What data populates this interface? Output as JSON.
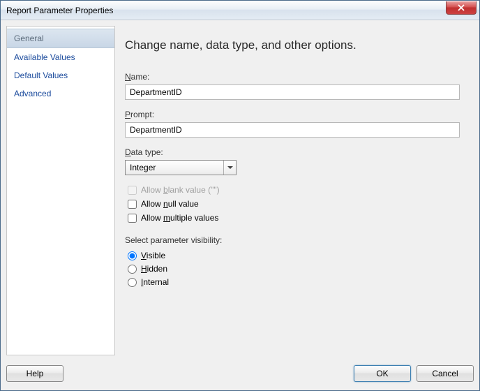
{
  "window": {
    "title": "Report Parameter Properties"
  },
  "sidebar": {
    "items": [
      {
        "label": "General",
        "selected": true
      },
      {
        "label": "Available Values",
        "selected": false
      },
      {
        "label": "Default Values",
        "selected": false
      },
      {
        "label": "Advanced",
        "selected": false
      }
    ]
  },
  "content": {
    "heading": "Change name, data type, and other options.",
    "name_label": "Name:",
    "name_value": "DepartmentID",
    "prompt_label": "Prompt:",
    "prompt_value": "DepartmentID",
    "datatype_label": "Data type:",
    "datatype_value": "Integer",
    "allow_blank_label": "Allow blank value (\"\")",
    "allow_blank_checked": false,
    "allow_blank_disabled": true,
    "allow_null_label": "Allow null value",
    "allow_null_checked": false,
    "allow_multiple_label": "Allow multiple values",
    "allow_multiple_checked": false,
    "visibility_label": "Select parameter visibility:",
    "visibility_options": [
      {
        "label": "Visible",
        "value": "visible",
        "checked": true
      },
      {
        "label": "Hidden",
        "value": "hidden",
        "checked": false
      },
      {
        "label": "Internal",
        "value": "internal",
        "checked": false
      }
    ]
  },
  "footer": {
    "help_label": "Help",
    "ok_label": "OK",
    "cancel_label": "Cancel"
  }
}
